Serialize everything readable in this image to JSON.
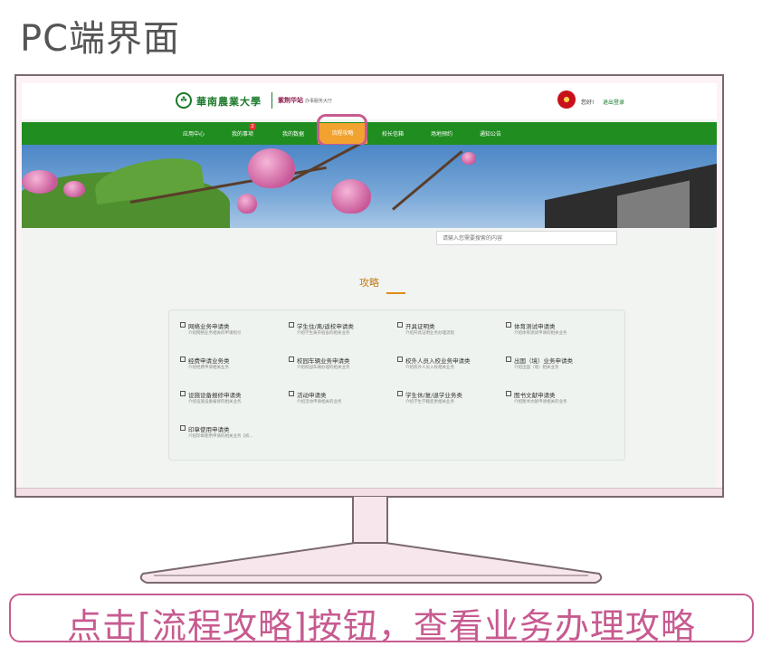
{
  "page_heading": "PC端界面",
  "header": {
    "university_name": "華南農業大學",
    "emblem_icon": "school-emblem-icon",
    "portal_name": "紫荆华站",
    "portal_subtitle": "办事服务大厅",
    "greeting": "您好!",
    "logout": "退出登录"
  },
  "nav": {
    "items": [
      {
        "label": "应用中心"
      },
      {
        "label": "我的事项"
      },
      {
        "label": "我的数据"
      },
      {
        "label": "流程攻略"
      },
      {
        "label": "校长信箱"
      },
      {
        "label": "场地预约"
      },
      {
        "label": "通知公告"
      }
    ],
    "active_index": 3,
    "todo_badge": "2"
  },
  "search": {
    "placeholder": "请输入您需要搜索的内容"
  },
  "section_title": "攻略",
  "guides": [
    {
      "title": "网络业务申请类",
      "desc": "介绍网络业务相关的申请指引"
    },
    {
      "title": "学生住/离/返校申请类",
      "desc": "介绍学生离开宿舍的相关业务"
    },
    {
      "title": "开具证明类",
      "desc": "介绍开具证明业务办理流程"
    },
    {
      "title": "体育测试申请类",
      "desc": "介绍体育测试申请的相关业务"
    },
    {
      "title": "经费申请业务类",
      "desc": "介绍经费申请相关业务"
    },
    {
      "title": "校园车辆业务申请类",
      "desc": "介绍校园车辆办理的相关业务"
    },
    {
      "title": "校外人员入校业务申请类",
      "desc": "介绍校外人员入校相关业务"
    },
    {
      "title": "出国（境）业务申请类",
      "desc": "介绍出国（境）相关业务"
    },
    {
      "title": "设施设备报修申请类",
      "desc": "介绍设施设备报修的相关业务"
    },
    {
      "title": "活动申请类",
      "desc": "介绍活动申请相关的业务"
    },
    {
      "title": "学生休/复/退学业务类",
      "desc": "介绍学生学籍变更相关业务"
    },
    {
      "title": "图书文献申请类",
      "desc": "介绍图书文献申请相关的业务"
    },
    {
      "title": "印章使用申请类",
      "desc": "介绍印章使用申请的相关业务【校..."
    }
  ],
  "caption": "点击[流程攻略]按钮，查看业务办理攻略",
  "colors": {
    "nav_green": "#1f8d20",
    "active_orange": "#f1a22f",
    "accent_pink": "#c75b90"
  }
}
